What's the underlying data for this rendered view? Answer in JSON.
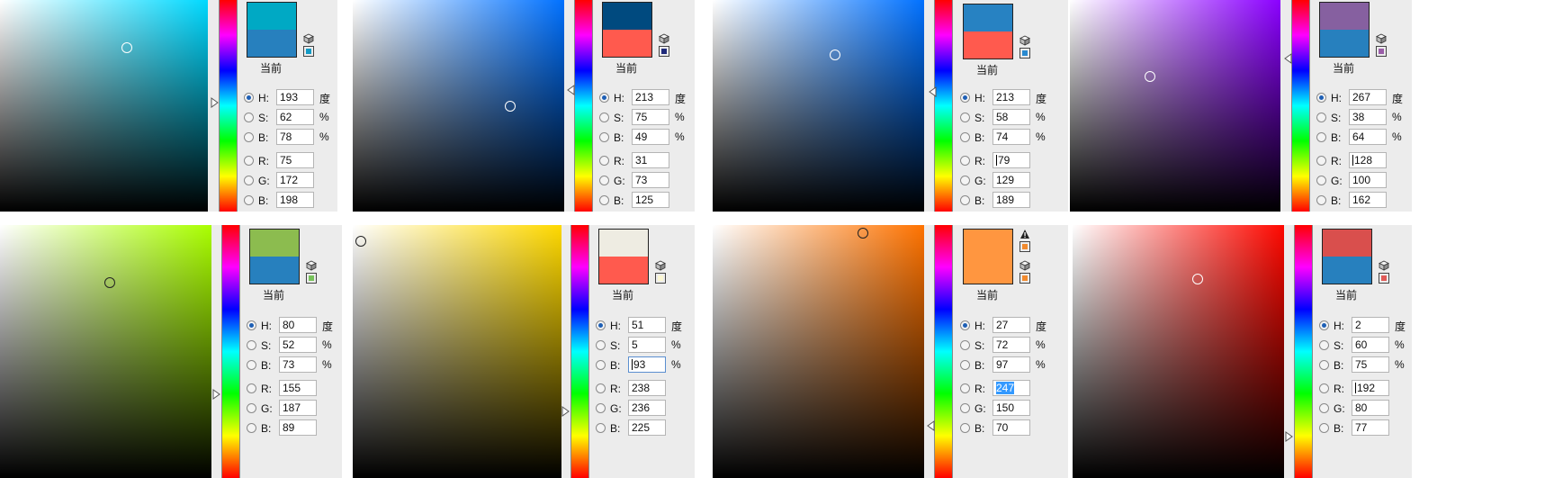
{
  "panels": [
    {
      "hue_hex": "#00d9ff",
      "new_color": "#00a9c4",
      "current_color": "#2780be",
      "mini_color": "#129ac5",
      "warning": false,
      "fields": [
        {
          "label": "H:",
          "value": "193",
          "unit": "度",
          "selected": true
        },
        {
          "label": "S:",
          "value": "62",
          "unit": "%"
        },
        {
          "label": "B:",
          "value": "78",
          "unit": "%"
        },
        {
          "label": "R:",
          "value": "75"
        },
        {
          "label": "G:",
          "value": "172"
        },
        {
          "label": "B:",
          "value": "198"
        }
      ]
    },
    {
      "hue_hex": "#0071ff",
      "new_color": "#004a7f",
      "current_color": "#ff5a4e",
      "mini_color": "#1f2a7a",
      "warning": false,
      "fields": [
        {
          "label": "H:",
          "value": "213",
          "unit": "度",
          "selected": true
        },
        {
          "label": "S:",
          "value": "75",
          "unit": "%"
        },
        {
          "label": "B:",
          "value": "49",
          "unit": "%"
        },
        {
          "label": "R:",
          "value": "31"
        },
        {
          "label": "G:",
          "value": "73"
        },
        {
          "label": "B:",
          "value": "125"
        }
      ]
    },
    {
      "hue_hex": "#0071ff",
      "new_color": "#2782c2",
      "current_color": "#ff5a4e",
      "mini_color": "#2a8ad0",
      "warning": false,
      "fields": [
        {
          "label": "H:",
          "value": "213",
          "unit": "度",
          "selected": true
        },
        {
          "label": "S:",
          "value": "58",
          "unit": "%"
        },
        {
          "label": "B:",
          "value": "74",
          "unit": "%"
        },
        {
          "label": "R:",
          "value": "79",
          "caret": true
        },
        {
          "label": "G:",
          "value": "129"
        },
        {
          "label": "B:",
          "value": "189"
        }
      ]
    },
    {
      "hue_hex": "#8b00ff",
      "new_color": "#8660a0",
      "current_color": "#2780be",
      "mini_color": "#9a5ea8",
      "warning": false,
      "fields": [
        {
          "label": "H:",
          "value": "267",
          "unit": "度",
          "selected": true
        },
        {
          "label": "S:",
          "value": "38",
          "unit": "%"
        },
        {
          "label": "B:",
          "value": "64",
          "unit": "%"
        },
        {
          "label": "R:",
          "value": "128",
          "caret": true
        },
        {
          "label": "G:",
          "value": "100"
        },
        {
          "label": "B:",
          "value": "162"
        }
      ]
    },
    {
      "hue_hex": "#aaff00",
      "new_color": "#8cbc4f",
      "current_color": "#2780be",
      "mini_color": "#77c25a",
      "warning": false,
      "fields": [
        {
          "label": "H:",
          "value": "80",
          "unit": "度",
          "selected": true
        },
        {
          "label": "S:",
          "value": "52",
          "unit": "%"
        },
        {
          "label": "B:",
          "value": "73",
          "unit": "%"
        },
        {
          "label": "R:",
          "value": "155"
        },
        {
          "label": "G:",
          "value": "187"
        },
        {
          "label": "B:",
          "value": "89"
        }
      ]
    },
    {
      "hue_hex": "#ffd900",
      "new_color": "#eeece2",
      "current_color": "#ff5a4e",
      "mini_color": "#fbf7d2",
      "warning": false,
      "fields": [
        {
          "label": "H:",
          "value": "51",
          "unit": "度",
          "selected": true
        },
        {
          "label": "S:",
          "value": "5",
          "unit": "%"
        },
        {
          "label": "B:",
          "value": "93",
          "unit": "%",
          "caret": true,
          "focus": true
        },
        {
          "label": "R:",
          "value": "238"
        },
        {
          "label": "G:",
          "value": "236"
        },
        {
          "label": "B:",
          "value": "225"
        }
      ]
    },
    {
      "hue_hex": "#ff7300",
      "new_color": "#ff9640",
      "current_color": "#ff9640",
      "mini_color": "#f18a2e",
      "warning": true,
      "fields": [
        {
          "label": "H:",
          "value": "27",
          "unit": "度",
          "selected": true
        },
        {
          "label": "S:",
          "value": "72",
          "unit": "%"
        },
        {
          "label": "B:",
          "value": "97",
          "unit": "%"
        },
        {
          "label": "R:",
          "value": "247",
          "highlight": true
        },
        {
          "label": "G:",
          "value": "150"
        },
        {
          "label": "B:",
          "value": "70"
        }
      ]
    },
    {
      "hue_hex": "#ff0800",
      "new_color": "#d94f4d",
      "current_color": "#2780be",
      "mini_color": "#e05a57",
      "warning": false,
      "fields": [
        {
          "label": "H:",
          "value": "2",
          "unit": "度",
          "selected": true
        },
        {
          "label": "S:",
          "value": "60",
          "unit": "%"
        },
        {
          "label": "B:",
          "value": "75",
          "unit": "%"
        },
        {
          "label": "R:",
          "value": "192",
          "caret": true
        },
        {
          "label": "G:",
          "value": "80"
        },
        {
          "label": "B:",
          "value": "77"
        }
      ]
    }
  ],
  "current_label": "当前",
  "icons": {
    "cube": "web-safe-cube-icon",
    "warning": "gamut-warning-icon"
  }
}
